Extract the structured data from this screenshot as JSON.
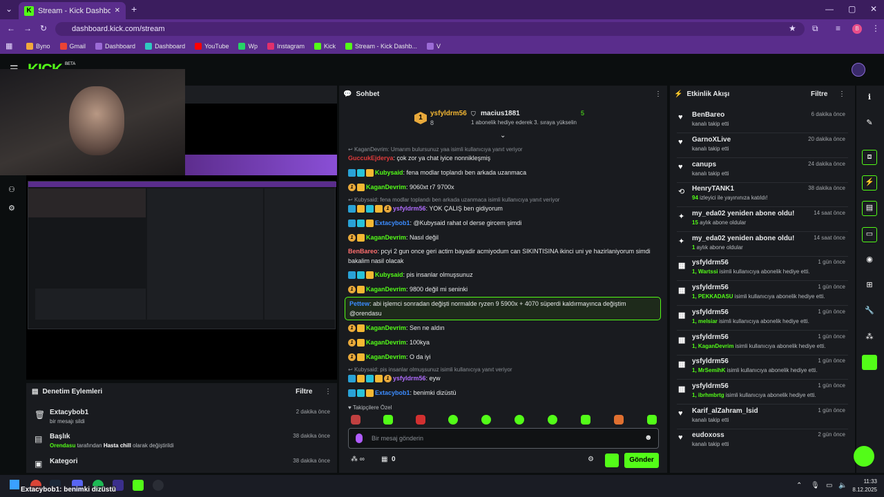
{
  "browser": {
    "tab_title": "Stream - Kick Dashboard",
    "url": "dashboard.kick.com/stream",
    "profile": "B",
    "bookmarks": [
      "Byno",
      "Gmail",
      "Dashboard",
      "Dashboard",
      "YouTube",
      "Wp",
      "Instagram",
      "Kick",
      "Stream - Kick Dashb...",
      "V"
    ]
  },
  "kick": {
    "logo": "KICK",
    "beta": "BETA"
  },
  "chat": {
    "title": "Sohbet",
    "top": {
      "rank": "1",
      "user1": "ysfyldrm56",
      "user1_count": "8",
      "user2": "macius1881",
      "user2_count": "5",
      "hint": "1 abonelik hediye ederek 3. sıraya yükselin"
    },
    "messages": [
      {
        "reply": "KaganDevrim: Umarım bulursunuz yaa isimli kullanıcıya yanıt veriyor"
      },
      {
        "user": "GuccukEjderya",
        "text": ": çok zor ya chat iyice nonnikleşmiş",
        "color": "#e03a3a"
      },
      {
        "user": "Kubysaid",
        "text": ": fena modlar toplandı ben arkada uzanmaca",
        "color": "#53fc18"
      },
      {
        "user": "KaganDevrim",
        "text": ": 9060xt r7 9700x",
        "color": "#53fc18"
      },
      {
        "reply": "Kubysaid: fena modlar toplandı ben arkada uzanmaca isimli kullanıcıya yanıt veriyor"
      },
      {
        "user": "ysfyldrm56",
        "text": ": YOK ÇALIŞ ben gidiyorum",
        "color": "#b06cff"
      },
      {
        "user": "Extacybob1",
        "text": ": @Kubysaid rahat ol derse gircem şimdi",
        "color": "#3b8cff"
      },
      {
        "user": "KaganDevrim",
        "text": ": Nasıl değil",
        "color": "#53fc18"
      },
      {
        "user": "BenBareo",
        "text": ": pcyi 2 gun once geri actim bayadir acmiyodum can SIKINTISINA ikinci uni ye hazirlaniyorum simdi bakalim nasil olacak",
        "color": "#ff6f6f"
      },
      {
        "user": "Kubysaid",
        "text": ": pis insanlar olmuşsunuz",
        "color": "#53fc18"
      },
      {
        "user": "KaganDevrim",
        "text": ": 9800 değil mi seninki",
        "color": "#53fc18"
      },
      {
        "user": "Pettew",
        "text": ": abi işlemci sonradan değişti normalde ryzen 9 5900x + 4070 süperdi kaldırmayınca değiştim @orendasu",
        "color": "#3b8cff"
      },
      {
        "user": "KaganDevrim",
        "text": ": Sen ne aldın",
        "color": "#53fc18"
      },
      {
        "user": "KaganDevrim",
        "text": ": 100kya",
        "color": "#53fc18"
      },
      {
        "user": "KaganDevrim",
        "text": ": O da iyi",
        "color": "#53fc18"
      },
      {
        "reply": "Kubysaid: pis insanlar olmuşsunuz isimli kullanıcıya yanıt veriyor"
      },
      {
        "user": "ysfyldrm56",
        "text": ": eyw",
        "color": "#b06cff"
      },
      {
        "user": "Extacybob1",
        "text": ": benimki dizüstü",
        "color": "#3b8cff"
      }
    ],
    "emotes_label": "Takipçilere Özel",
    "input_placeholder": "Bir mesaj gönderin",
    "points": "0",
    "send": "Gönder"
  },
  "activity": {
    "title": "Etkinlik Akışı",
    "filter": "Filtre",
    "items": [
      {
        "icon": "♥",
        "name": "BenBareo",
        "sub": "kanalı takip etti",
        "time": "6 dakika önce"
      },
      {
        "icon": "♥",
        "name": "GarnoXLive",
        "sub": "kanalı takip etti",
        "time": "20 dakika önce"
      },
      {
        "icon": "♥",
        "name": "canups",
        "sub": "kanalı takip etti",
        "time": "24 dakika önce"
      },
      {
        "icon": "⟲",
        "name": "HenryTANK1",
        "subg": "94",
        "sub": " izleyici ile yayınınıza katıldı!",
        "time": "38 dakika önce"
      },
      {
        "icon": "✦",
        "name": "my_eda02 yeniden abone oldu!",
        "subg": "15",
        "sub": " aylık abone oldular",
        "time": "14 saat önce"
      },
      {
        "icon": "✦",
        "name": "my_eda02 yeniden abone oldu!",
        "subg": "1",
        "sub": " aylık abone oldular",
        "time": "14 saat önce"
      },
      {
        "icon": "▦",
        "name": "ysfyldrm56",
        "subg": "1, Wartssi",
        "sub": " isimli kullanıcıya abonelik hediye etti.",
        "time": "1 gün önce"
      },
      {
        "icon": "▦",
        "name": "ysfyldrm56",
        "subg": "1, PEKKADASU",
        "sub": " isimli kullanıcıya abonelik hediye etti.",
        "time": "1 gün önce"
      },
      {
        "icon": "▦",
        "name": "ysfyldrm56",
        "subg": "1, melsiar",
        "sub": " isimli kullanıcıya abonelik hediye etti.",
        "time": "1 gün önce"
      },
      {
        "icon": "▦",
        "name": "ysfyldrm56",
        "subg": "1, KaganDevrim",
        "sub": " isimli kullanıcıya abonelik hediye etti.",
        "time": "1 gün önce"
      },
      {
        "icon": "▦",
        "name": "ysfyldrm56",
        "subg": "1, MrSemihK",
        "sub": " isimli kullanıcıya abonelik hediye etti.",
        "time": "1 gün önce"
      },
      {
        "icon": "▦",
        "name": "ysfyldrm56",
        "subg": "1, ibrhmbrtg",
        "sub": " isimli kullanıcıya abonelik hediye etti.",
        "time": "1 gün önce"
      },
      {
        "icon": "♥",
        "name": "Karif_alZahram_lsid",
        "sub": "kanalı takip etti",
        "time": "1 gün önce"
      },
      {
        "icon": "♥",
        "name": "eudoxoss",
        "sub": "kanalı takip etti",
        "time": "2 gün önce"
      }
    ]
  },
  "moderation": {
    "title": "Denetim Eylemleri",
    "filter": "Filtre",
    "items": [
      {
        "icon": "🗑",
        "name": "Extacybob1",
        "sub": "bir mesajı sildi",
        "time": "2 dakika önce"
      },
      {
        "icon": "▤",
        "name": "Başlık",
        "subg": "Orendasu",
        "sub": " tarafından ",
        "subb": "Hasta chill",
        "sub2": " olarak değiştirildi",
        "time": "38 dakika önce"
      },
      {
        "icon": "▣",
        "name": "Kategori",
        "sub": "",
        "time": "38 dakika önce"
      }
    ]
  },
  "taskbar": {
    "notification": "Extacybob1: benimki dizüstü",
    "time": "11:33",
    "date": "8.12.2025"
  }
}
